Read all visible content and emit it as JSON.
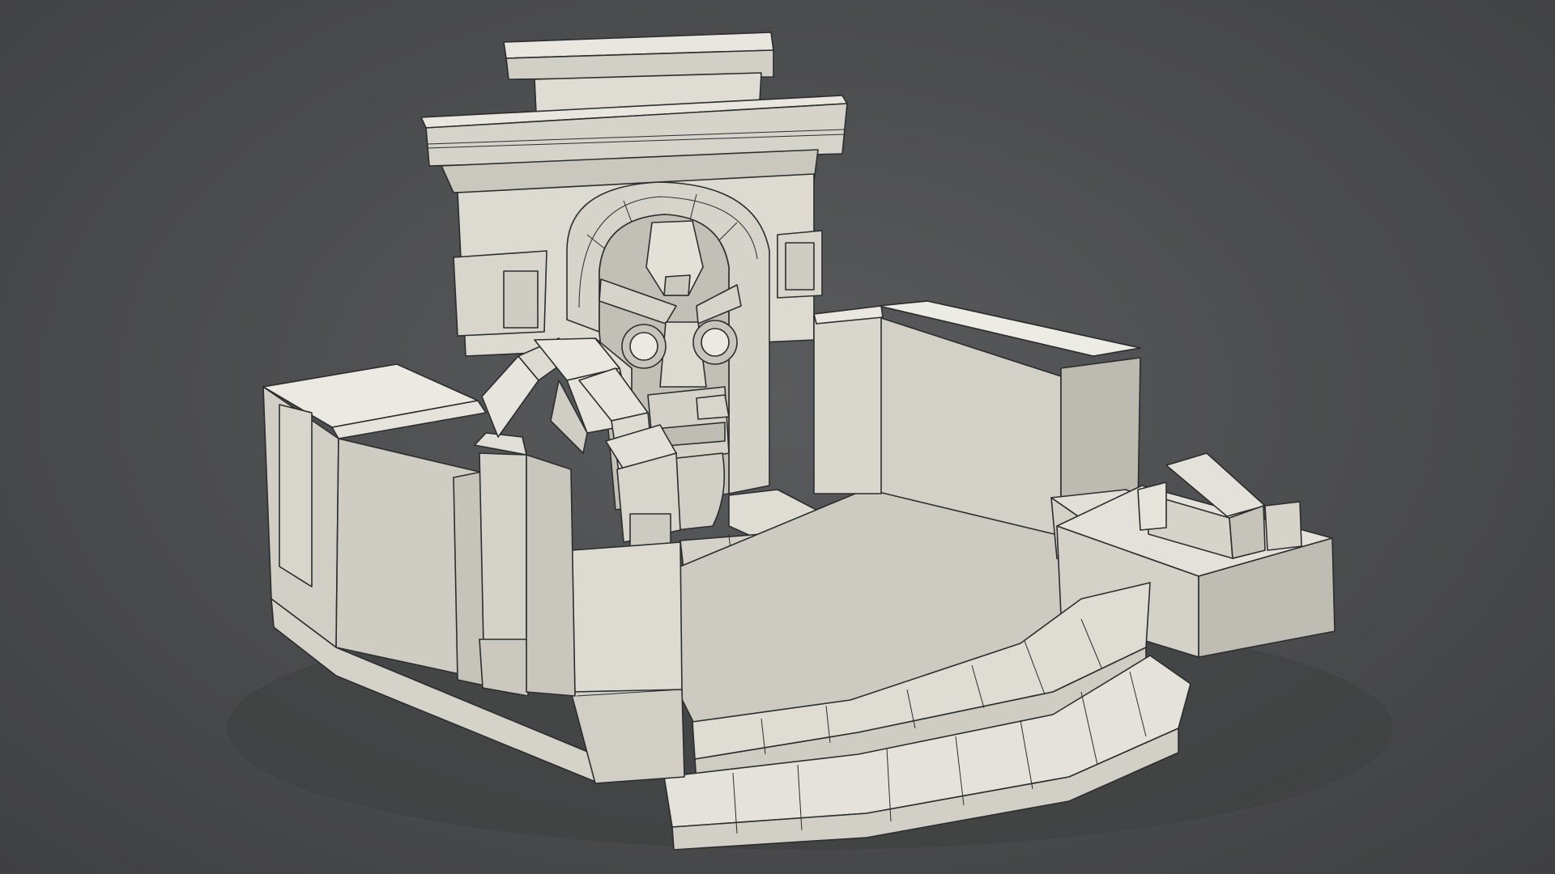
{
  "viewport": {
    "background_color": "#4b4c4d",
    "model_colors": {
      "light": "#e6e4dc",
      "mid": "#cfccc3",
      "shade": "#b8b6ae",
      "dark": "#9d9c96",
      "wire": "#2b2d2f"
    },
    "subject": "clay-render-stone-fountain-shrine"
  }
}
